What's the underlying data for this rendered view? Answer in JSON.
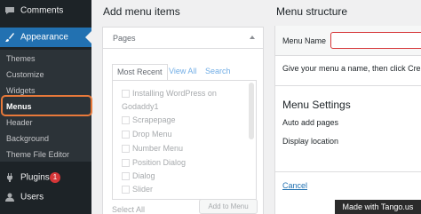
{
  "sidebar": {
    "comments": "Comments",
    "appearance": "Appearance",
    "submenu": [
      "Themes",
      "Customize",
      "Widgets",
      "Menus",
      "Header",
      "Background",
      "Theme File Editor"
    ],
    "plugins": "Plugins",
    "plugins_badge": "1",
    "users": "Users"
  },
  "add_items": {
    "title": "Add menu items",
    "pages_section": "Pages",
    "tabs": [
      "Most Recent",
      "View All",
      "Search"
    ],
    "pages": [
      "Installing WordPress on",
      "Godaddy1",
      "Scrapepage",
      "Drop Menu",
      "Number Menu",
      "Position Dialog",
      "Dialog",
      "Slider"
    ],
    "select_all": "Select All",
    "add_button": "Add to Menu"
  },
  "structure": {
    "title": "Menu structure",
    "menu_name_label": "Menu Name",
    "menu_name_value": "",
    "helper": "Give your menu a name, then click Create",
    "settings_title": "Menu Settings",
    "auto_add": "Auto add pages",
    "display_location": "Display location",
    "cancel": "Cancel"
  },
  "watermark": "Made with Tango.us",
  "colors": {
    "sidebar_bg": "#1d2327",
    "active_bg": "#2271b1",
    "highlight": "#e8793a",
    "badge": "#d63638"
  }
}
